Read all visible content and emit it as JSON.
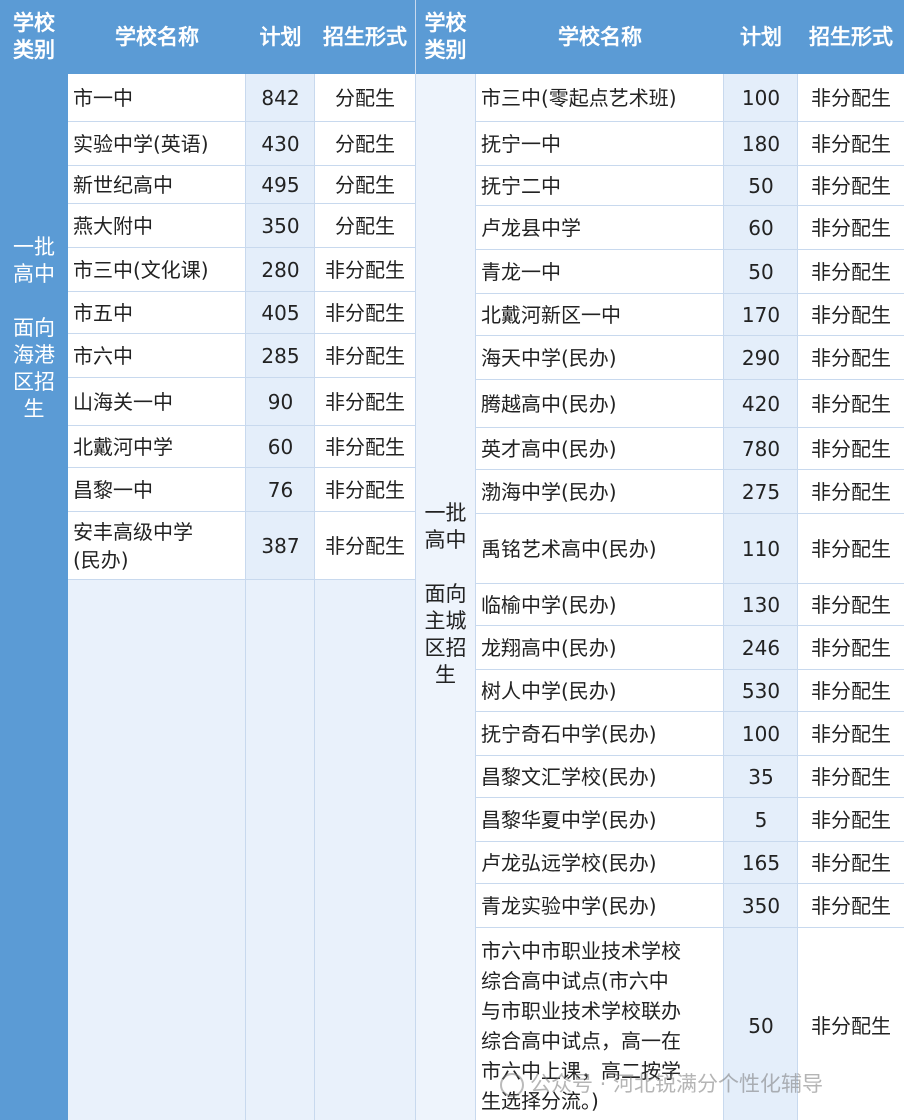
{
  "header": {
    "col_category": "学校类别",
    "col_name": "学校名称",
    "col_plan": "计划",
    "col_form": "招生形式"
  },
  "left": {
    "category": "一批高中\n\n面向海港区招生",
    "rows": [
      {
        "name": "市一中",
        "plan": "842",
        "form": "分配生"
      },
      {
        "name": "实验中学(英语)",
        "plan": "430",
        "form": "分配生"
      },
      {
        "name": "新世纪高中",
        "plan": "495",
        "form": "分配生"
      },
      {
        "name": "燕大附中",
        "plan": "350",
        "form": "分配生"
      },
      {
        "name": "市三中(文化课)",
        "plan": "280",
        "form": "非分配生"
      },
      {
        "name": "市五中",
        "plan": "405",
        "form": "非分配生"
      },
      {
        "name": "市六中",
        "plan": "285",
        "form": "非分配生"
      },
      {
        "name": "山海关一中",
        "plan": "90",
        "form": "非分配生"
      },
      {
        "name": "北戴河中学",
        "plan": "60",
        "form": "非分配生"
      },
      {
        "name": "昌黎一中",
        "plan": "76",
        "form": "非分配生"
      },
      {
        "name": "安丰高级中学\n(民办)",
        "plan": "387",
        "form": "非分配生"
      }
    ]
  },
  "right": {
    "category": "一批高中\n\n面向主城区招生",
    "rows": [
      {
        "name": "市三中(零起点艺术班)",
        "plan": "100",
        "form": "非分配生"
      },
      {
        "name": "抚宁一中",
        "plan": "180",
        "form": "非分配生"
      },
      {
        "name": "抚宁二中",
        "plan": "50",
        "form": "非分配生"
      },
      {
        "name": "卢龙县中学",
        "plan": "60",
        "form": "非分配生"
      },
      {
        "name": "青龙一中",
        "plan": "50",
        "form": "非分配生"
      },
      {
        "name": "北戴河新区一中",
        "plan": "170",
        "form": "非分配生"
      },
      {
        "name": "海天中学(民办)",
        "plan": "290",
        "form": "非分配生"
      },
      {
        "name": "腾越高中(民办)",
        "plan": "420",
        "form": "非分配生"
      },
      {
        "name": "英才高中(民办)",
        "plan": "780",
        "form": "非分配生"
      },
      {
        "name": "渤海中学(民办)",
        "plan": "275",
        "form": "非分配生"
      },
      {
        "name": "禹铭艺术高中(民办)",
        "plan": "110",
        "form": "非分配生"
      },
      {
        "name": "临榆中学(民办)",
        "plan": "130",
        "form": "非分配生"
      },
      {
        "name": "龙翔高中(民办)",
        "plan": "246",
        "form": "非分配生"
      },
      {
        "name": "树人中学(民办)",
        "plan": "530",
        "form": "非分配生"
      },
      {
        "name": "抚宁奇石中学(民办)",
        "plan": "100",
        "form": "非分配生"
      },
      {
        "name": "昌黎文汇学校(民办)",
        "plan": "35",
        "form": "非分配生"
      },
      {
        "name": "昌黎华夏中学(民办)",
        "plan": "5",
        "form": "非分配生"
      },
      {
        "name": "卢龙弘远学校(民办)",
        "plan": "165",
        "form": "非分配生"
      },
      {
        "name": "青龙实验中学(民办)",
        "plan": "350",
        "form": "非分配生"
      },
      {
        "name": "市六中市职业技术学校\n综合高中试点(市六中\n与市职业技术学校联办\n综合高中试点，高一在\n市六中上课，高二按学\n生选择分流。)",
        "plan": "50",
        "form": "非分配生"
      }
    ]
  },
  "watermark": "公众号 · 河北锐满分个性化辅导"
}
